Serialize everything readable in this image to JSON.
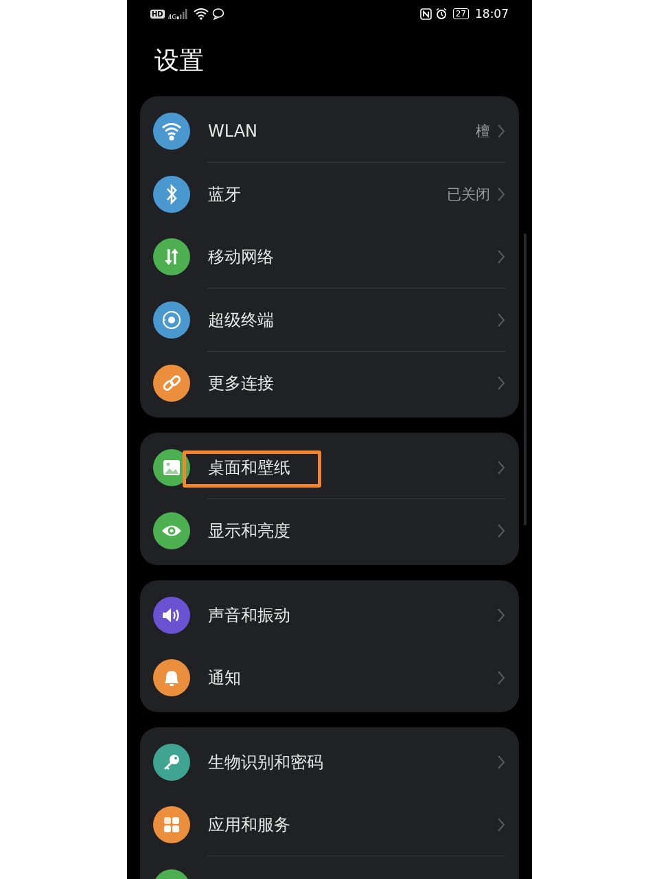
{
  "status_bar": {
    "hd": "HD",
    "network": "4G",
    "battery": "27",
    "time": "18:07"
  },
  "title": "设置",
  "groups": [
    {
      "items": [
        {
          "kind": "wifi",
          "label": "WLAN",
          "value": "檀",
          "separator": true,
          "highlighted": false
        },
        {
          "kind": "bluetooth",
          "label": "蓝牙",
          "value": "已关闭",
          "separator": false,
          "highlighted": false
        },
        {
          "kind": "mobile-data",
          "label": "移动网络",
          "separator": true,
          "highlighted": false
        },
        {
          "kind": "devices",
          "label": "超级终端",
          "separator": true,
          "highlighted": false
        },
        {
          "kind": "link",
          "label": "更多连接",
          "separator": false,
          "highlighted": false
        }
      ]
    },
    {
      "items": [
        {
          "kind": "image",
          "label": "桌面和壁纸",
          "separator": true,
          "highlighted": true
        },
        {
          "kind": "eye",
          "label": "显示和亮度",
          "separator": false,
          "highlighted": false
        }
      ]
    },
    {
      "items": [
        {
          "kind": "sound",
          "label": "声音和振动",
          "separator": false,
          "highlighted": false
        },
        {
          "kind": "bell",
          "label": "通知",
          "separator": false,
          "highlighted": false
        }
      ]
    },
    {
      "items": [
        {
          "kind": "key",
          "label": "生物识别和密码",
          "separator": false,
          "highlighted": false
        },
        {
          "kind": "apps",
          "label": "应用和服务",
          "separator": true,
          "highlighted": false
        },
        {
          "kind": "plain",
          "separator": false,
          "highlighted": false
        }
      ]
    }
  ]
}
